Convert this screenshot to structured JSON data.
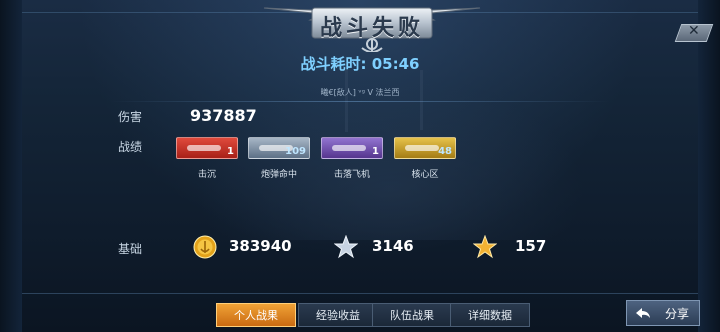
{
  "header": {
    "title": "战斗失败",
    "duration_label": "战斗耗时: 05:46"
  },
  "matchup": {
    "text": "曦€[敌人] ᵛᵍ  V  法兰西"
  },
  "stats": {
    "damage_label": "伤害",
    "damage_value": "937887",
    "record_label": "战绩",
    "cards": [
      {
        "caption": "击沉",
        "count": "1",
        "color": "#d7302a",
        "icon": "sunk-ship-icon"
      },
      {
        "caption": "炮弹命中",
        "count": "109",
        "color": "#7a8ea3",
        "icon": "shell-hit-icon"
      },
      {
        "caption": "击落飞机",
        "count": "1",
        "color": "#6e4aa8",
        "icon": "plane-down-icon"
      },
      {
        "caption": "核心区",
        "count": "48",
        "color": "#caa028",
        "icon": "core-zone-icon"
      }
    ],
    "basic_label": "基础",
    "basic": [
      {
        "value": "383940",
        "icon": "gold-coin-icon"
      },
      {
        "value": "3146",
        "icon": "silver-star-icon"
      },
      {
        "value": "157",
        "icon": "gold-star-icon"
      }
    ]
  },
  "tabs": [
    {
      "label": "个人战果",
      "active": true
    },
    {
      "label": "经验收益",
      "active": false
    },
    {
      "label": "队伍战果",
      "active": false
    },
    {
      "label": "详细数据",
      "active": false
    }
  ],
  "share": {
    "label": "分享"
  },
  "colors": {
    "accent_blue": "#7fd0ff",
    "tab_active": "#e8902a"
  }
}
